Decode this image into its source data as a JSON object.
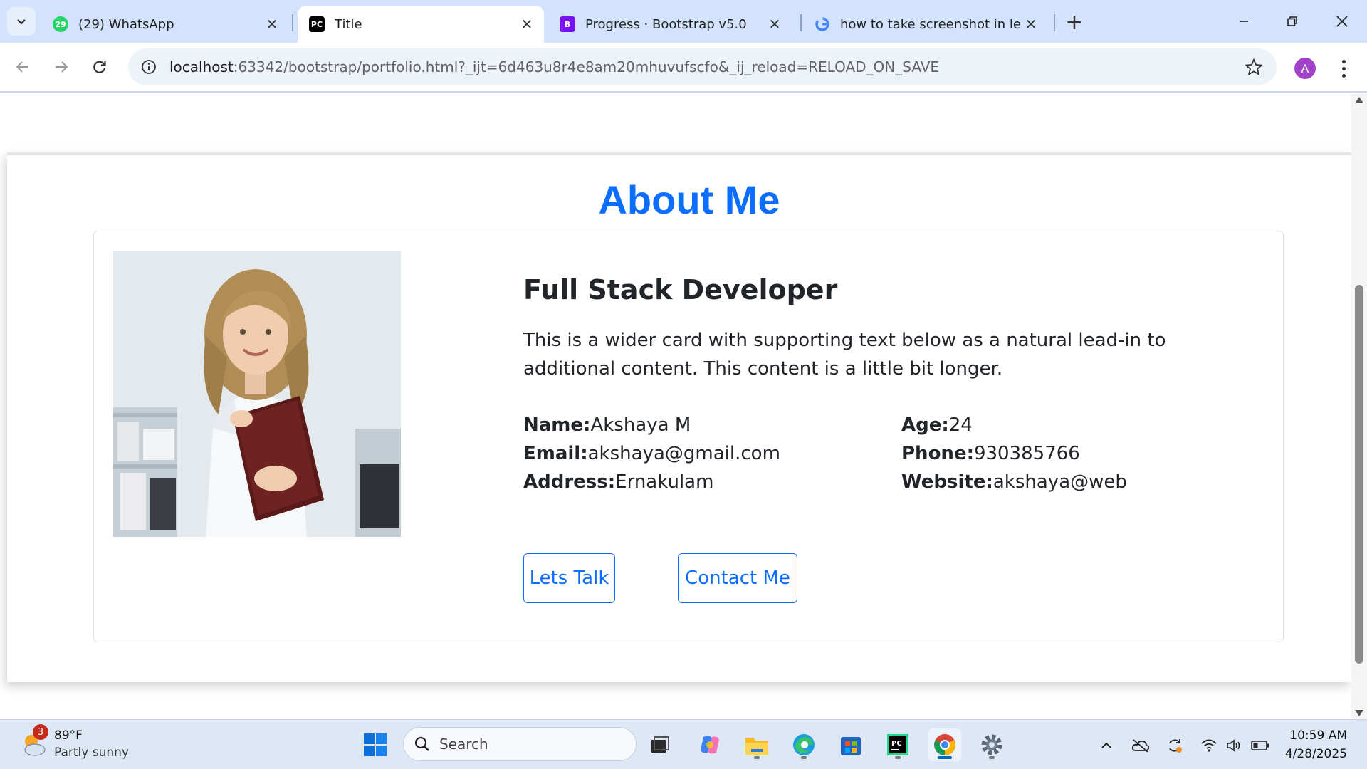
{
  "browser": {
    "tabs": [
      {
        "label": "(29) WhatsApp",
        "badge": "29",
        "active": false
      },
      {
        "label": "Title",
        "active": true
      },
      {
        "label": "Progress · Bootstrap v5.0",
        "active": false
      },
      {
        "label": "how to take screenshot in lenov",
        "active": false
      }
    ],
    "address": {
      "host": "localhost",
      "rest": ":63342/bootstrap/portfolio.html?_ijt=6d463u8r4e8am20mhuvufscfo&_ij_reload=RELOAD_ON_SAVE"
    },
    "profile_initial": "A"
  },
  "page": {
    "section_title": "About Me",
    "job_title": "Full Stack Developer",
    "description": "This is a wider card with supporting text below as a natural lead-in to additional content. This content is a little bit longer.",
    "info": {
      "name_label": "Name:",
      "name_value": "Akshaya M",
      "email_label": "Email:",
      "email_value": "akshaya@gmail.com",
      "address_label": "Address:",
      "address_value": "Ernakulam",
      "age_label": "Age:",
      "age_value": "24",
      "phone_label": "Phone:",
      "phone_value": "930385766",
      "website_label": "Website:",
      "website_value": "akshaya@web"
    },
    "buttons": {
      "lets_talk": "Lets Talk",
      "contact_me": "Contact Me"
    },
    "accent_color": "#0d6efd"
  },
  "taskbar": {
    "weather": {
      "temp": "89°F",
      "desc": "Partly sunny",
      "badge": "3"
    },
    "search_label": "Search",
    "clock": {
      "time": "10:59 AM",
      "date": "4/28/2025"
    }
  }
}
